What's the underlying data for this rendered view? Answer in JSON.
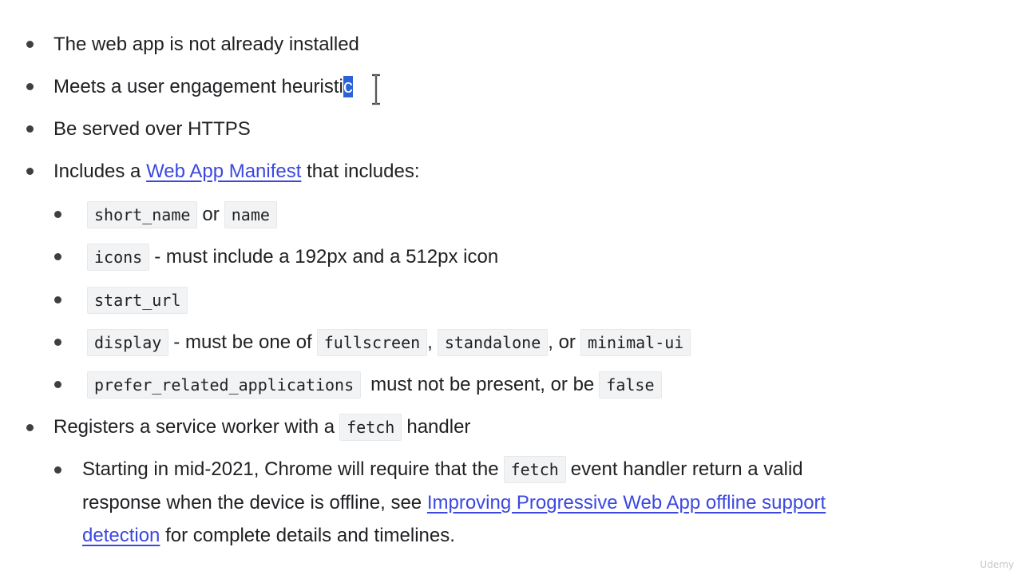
{
  "list": {
    "item1": "The web app is not already installed",
    "item2_main": "Meets a user engagement heuristi",
    "item2_selected": "c",
    "item3": "Be served over HTTPS",
    "item4_pre": "Includes a ",
    "item4_link": "Web App Manifest",
    "item4_post": " that includes:",
    "manifest": {
      "short_name": "short_name",
      "or_text": "or",
      "name": "name",
      "icons": "icons",
      "icons_desc": "- must include a 192px and a 512px icon",
      "start_url": "start_url",
      "display": "display",
      "display_desc": "- must be one of",
      "fullscreen": "fullscreen",
      "comma": ",",
      "standalone": "standalone",
      "comma_or": ", or",
      "minimal_ui": "minimal-ui",
      "prefer": "prefer_related_applications",
      "prefer_desc": "must not be present, or be",
      "false": "false"
    },
    "item5_pre": "Registers a service worker with a",
    "item5_code": "fetch",
    "item5_post": "handler",
    "sub": {
      "pre": "Starting in mid-2021, Chrome will require that the",
      "code": "fetch",
      "post": "event handler return a valid",
      "line2_pre": "response when the device is offline, see ",
      "link1": "Improving Progressive Web App offline support",
      "link2": "detection",
      "line3_post": " for complete details and timelines."
    }
  },
  "watermark": "Udemy"
}
